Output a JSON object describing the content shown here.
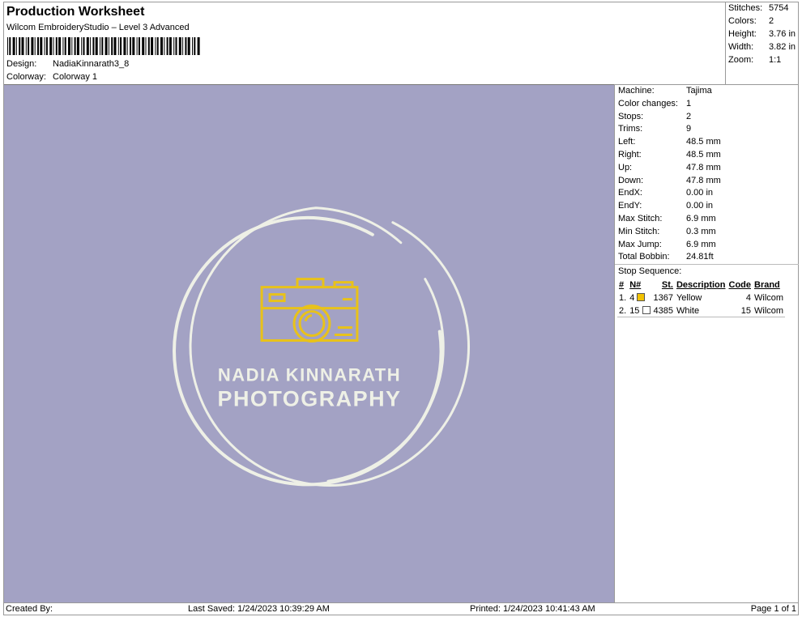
{
  "header": {
    "title": "Production Worksheet",
    "subtitle": "Wilcom EmbroideryStudio – Level 3 Advanced",
    "design_label": "Design:",
    "design_value": "NadiaKinnarath3_8",
    "colorway_label": "Colorway:",
    "colorway_value": "Colorway 1"
  },
  "stats": [
    {
      "k": "Stitches:",
      "v": "5754"
    },
    {
      "k": "Colors:",
      "v": "2"
    },
    {
      "k": "Height:",
      "v": "3.76 in"
    },
    {
      "k": "Width:",
      "v": "3.82 in"
    },
    {
      "k": "Zoom:",
      "v": "1:1"
    }
  ],
  "info": [
    {
      "k": "Machine:",
      "v": "Tajima"
    },
    {
      "k": "Color changes:",
      "v": "1"
    },
    {
      "k": "Stops:",
      "v": "2"
    },
    {
      "k": "Trims:",
      "v": "9"
    },
    {
      "k": "Left:",
      "v": "48.5 mm"
    },
    {
      "k": "Right:",
      "v": "48.5 mm"
    },
    {
      "k": "Up:",
      "v": "47.8 mm"
    },
    {
      "k": "Down:",
      "v": "47.8 mm"
    },
    {
      "k": "EndX:",
      "v": "0.00 in"
    },
    {
      "k": "EndY:",
      "v": "0.00 in"
    },
    {
      "k": "Max Stitch:",
      "v": "6.9 mm"
    },
    {
      "k": "Min Stitch:",
      "v": "0.3 mm"
    },
    {
      "k": "Max Jump:",
      "v": "6.9 mm"
    },
    {
      "k": "Total Bobbin:",
      "v": "24.81ft"
    }
  ],
  "stop_sequence": {
    "label": "Stop Sequence:",
    "headers": [
      "#",
      "N#",
      "St.",
      "Description",
      "Code",
      "Brand"
    ],
    "rows": [
      {
        "idx": "1.",
        "n": "4",
        "color": "#f2c200",
        "st": "1367",
        "desc": "Yellow",
        "code": "4",
        "brand": "Wilcom"
      },
      {
        "idx": "2.",
        "n": "15",
        "color": "#ffffff",
        "st": "4385",
        "desc": "White",
        "code": "15",
        "brand": "Wilcom"
      }
    ]
  },
  "design": {
    "line1": "NADIA KINNARATH",
    "line2": "PHOTOGRAPHY",
    "bg": "#a3a2c4",
    "thread_yellow": "#e8c21a",
    "thread_white": "#eef0e6"
  },
  "footer": {
    "created": "Created By:",
    "saved": "Last Saved: 1/24/2023 10:39:29 AM",
    "printed": "Printed: 1/24/2023 10:41:43 AM",
    "page": "Page 1 of 1"
  }
}
